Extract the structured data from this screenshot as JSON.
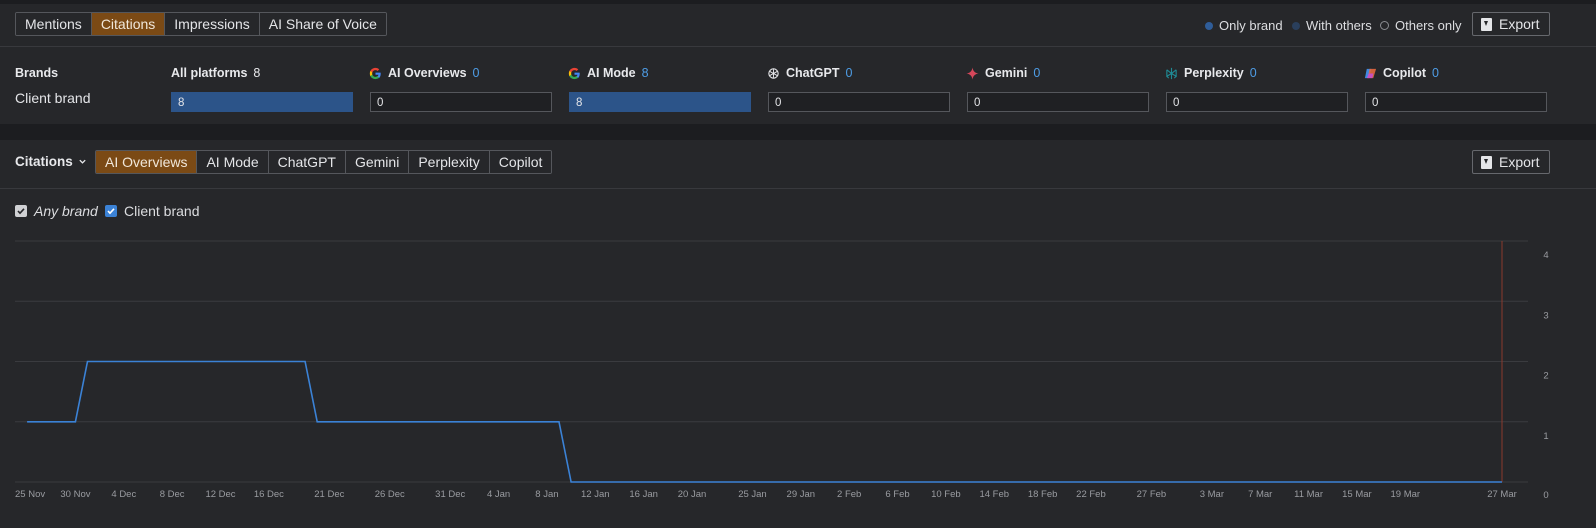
{
  "top": {
    "tabs": [
      {
        "label": "Mentions",
        "active": false
      },
      {
        "label": "Citations",
        "active": true
      },
      {
        "label": "Impressions",
        "active": false
      },
      {
        "label": "AI Share of Voice",
        "active": false
      }
    ],
    "filters": [
      {
        "label": "Only brand",
        "color": "#2f5d99"
      },
      {
        "label": "With others",
        "color": "#2a3f5c"
      },
      {
        "label": "Others only",
        "color": "outline"
      }
    ],
    "export_label": "Export"
  },
  "table": {
    "brands_header": "Brands",
    "row_label": "Client brand",
    "columns": [
      {
        "label": "All platforms",
        "count": "8",
        "icon": "none",
        "value": "8"
      },
      {
        "label": "AI Overviews",
        "count": "0",
        "icon": "google-icon",
        "value": "0"
      },
      {
        "label": "AI Mode",
        "count": "8",
        "icon": "google-icon",
        "value": "8"
      },
      {
        "label": "ChatGPT",
        "count": "0",
        "icon": "chatgpt-icon",
        "value": "0"
      },
      {
        "label": "Gemini",
        "count": "0",
        "icon": "gemini-icon",
        "value": "0"
      },
      {
        "label": "Perplexity",
        "count": "0",
        "icon": "perplexity-icon",
        "value": "0"
      },
      {
        "label": "Copilot",
        "count": "0",
        "icon": "copilot-icon",
        "value": "0"
      }
    ]
  },
  "chart_panel": {
    "metric_label": "Citations",
    "platform_tabs": [
      {
        "label": "AI Overviews",
        "active": true
      },
      {
        "label": "AI Mode",
        "active": false
      },
      {
        "label": "ChatGPT",
        "active": false
      },
      {
        "label": "Gemini",
        "active": false
      },
      {
        "label": "Perplexity",
        "active": false
      },
      {
        "label": "Copilot",
        "active": false
      }
    ],
    "export_label": "Export",
    "checkboxes": [
      {
        "label": "Any brand",
        "checked": true,
        "italic": true,
        "color": "#d0d1d4"
      },
      {
        "label": "Client brand",
        "checked": true,
        "italic": false,
        "color": "#3b82d6"
      }
    ]
  },
  "chart_data": {
    "type": "line",
    "x_tick_labels": [
      "25 Nov",
      "30 Nov",
      "4 Dec",
      "8 Dec",
      "12 Dec",
      "16 Dec",
      "21 Dec",
      "26 Dec",
      "31 Dec",
      "4 Jan",
      "8 Jan",
      "12 Jan",
      "16 Jan",
      "20 Jan",
      "25 Jan",
      "29 Jan",
      "2 Feb",
      "6 Feb",
      "10 Feb",
      "14 Feb",
      "18 Feb",
      "22 Feb",
      "27 Feb",
      "3 Mar",
      "7 Mar",
      "11 Mar",
      "15 Mar",
      "19 Mar",
      "27 Mar"
    ],
    "y_ticks": [
      0,
      1,
      2,
      3,
      4
    ],
    "ylim": [
      0,
      4
    ],
    "grid": true,
    "series": [
      {
        "name": "Client brand",
        "color": "#3b82d6",
        "x": [
          "26 Nov",
          "30 Nov",
          "1 Dec",
          "19 Dec",
          "20 Dec",
          "9 Jan",
          "10 Jan",
          "27 Mar"
        ],
        "y": [
          1,
          1,
          2,
          2,
          1,
          1,
          0,
          0
        ]
      }
    ],
    "marker": {
      "date": "27 Mar",
      "color": "#8b3a2c"
    }
  }
}
